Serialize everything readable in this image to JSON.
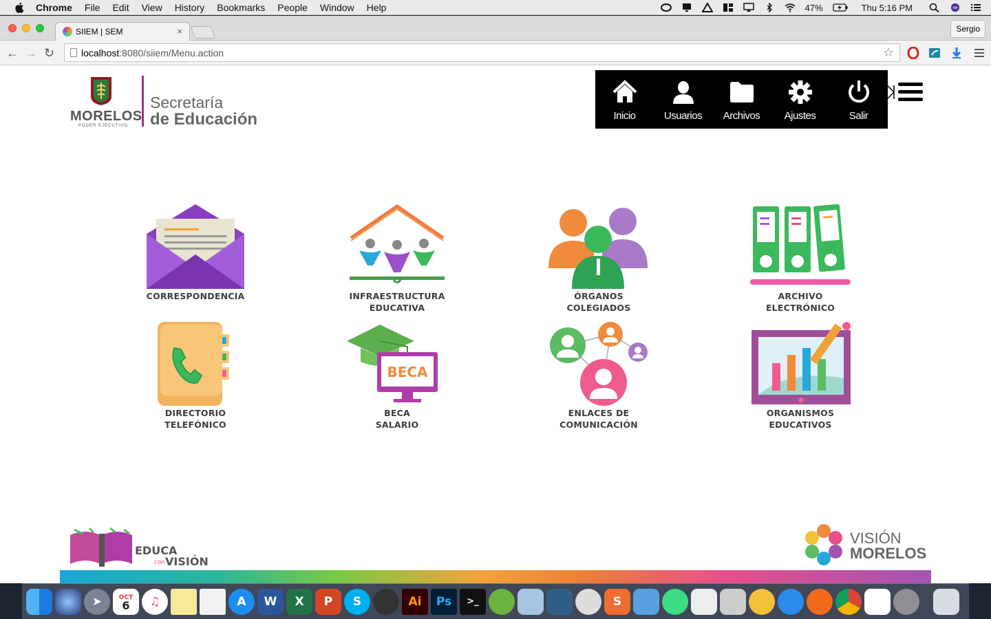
{
  "menubar": {
    "app_name": "Chrome",
    "menus": [
      "File",
      "Edit",
      "View",
      "History",
      "Bookmarks",
      "People",
      "Window",
      "Help"
    ],
    "battery": "47%",
    "clock": "Thu 5:16 PM"
  },
  "browser": {
    "tab_title": "SIIEM | SEM",
    "tab_close": "×",
    "profile_name": "Sergio",
    "url_host": "localhost",
    "url_path": ":8080/siiem/Menu.action"
  },
  "header": {
    "logo": {
      "state_name": "MORELOS",
      "state_sub": "PODER EJECUTIVO",
      "secretaria_line1": "Secretaría",
      "secretaria_line2": "de Educación"
    },
    "nav": [
      {
        "label": "Inicio",
        "icon": "home-icon"
      },
      {
        "label": "Usuarios",
        "icon": "user-icon"
      },
      {
        "label": "Archivos",
        "icon": "folder-icon"
      },
      {
        "label": "Ajustes",
        "icon": "gear-icon"
      },
      {
        "label": "Salir",
        "icon": "power-icon"
      }
    ]
  },
  "modules": [
    {
      "line1": "CORRESPONDENCIA",
      "line2": "",
      "icon": "envelope-icon"
    },
    {
      "line1": "INFRAESTRUCTURA",
      "line2": "EDUCATIVA",
      "icon": "school-house-icon"
    },
    {
      "line1": "ÓRGANOS",
      "line2": "COLEGIADOS",
      "icon": "people-group-icon"
    },
    {
      "line1": "ARCHIVO",
      "line2": "ELECTRÓNICO",
      "icon": "binders-icon"
    },
    {
      "line1": "DIRECTORIO",
      "line2": "TELEFÓNICO",
      "icon": "phone-book-icon"
    },
    {
      "line1": "BECA",
      "line2": "SALARIO",
      "icon": "graduation-beca-icon",
      "icon_text": "BECA"
    },
    {
      "line1": "ENLACES DE",
      "line2": "COMUNICACIÓN",
      "icon": "network-people-icon"
    },
    {
      "line1": "ORGANISMOS",
      "line2": "EDUCATIVOS",
      "icon": "chart-board-icon"
    }
  ],
  "footer": {
    "left_logo": {
      "word1": "EDUCA",
      "word2": "con",
      "word3": "VISIÓN"
    },
    "right_logo": {
      "line1": "VISIÓN",
      "line2": "MORELOS"
    }
  },
  "dock": {
    "calendar_month": "OCT",
    "calendar_day": "6",
    "word_letter": "W",
    "excel_letter": "X",
    "ppt_letter": "P",
    "skype_letter": "S",
    "illustrator": "Ai",
    "photoshop": "Ps",
    "terminal": ">_"
  },
  "colors": {
    "nav_bg": "#000000",
    "label_text": "#3d3d3d",
    "purple": "#9b4fc9",
    "green": "#3cb95c",
    "pink": "#e94f8b",
    "orange": "#f08a3c"
  }
}
